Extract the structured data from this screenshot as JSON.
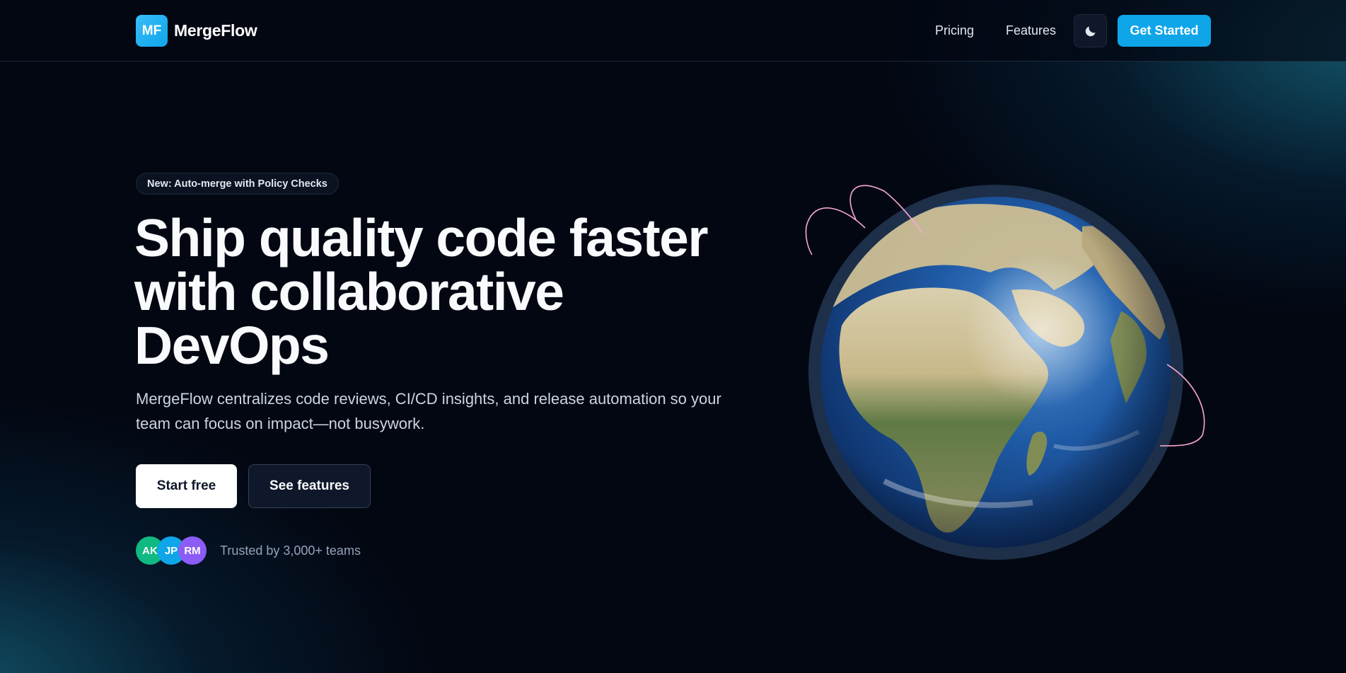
{
  "header": {
    "logo_initials": "MF",
    "brand_name": "MergeFlow",
    "nav": {
      "pricing": "Pricing",
      "features": "Features"
    },
    "theme_toggle_icon": "moon-icon",
    "cta": "Get Started"
  },
  "hero": {
    "badge": "New: Auto-merge with Policy Checks",
    "headline_line1": "Ship quality code faster",
    "headline_line2": "with collaborative",
    "headline_line3": "DevOps",
    "subtext": "MergeFlow centralizes code reviews, CI/CD insights, and release automation so your team can focus on impact—not busywork.",
    "primary_button": "Start free",
    "secondary_button": "See features",
    "avatars": [
      "AK",
      "JP",
      "RM"
    ],
    "trust_text": "Trusted by 3,000+ teams"
  },
  "colors": {
    "background": "#030712",
    "accent": "#0ea5e9",
    "avatar_1": "#10b981",
    "avatar_2": "#0ea5e9",
    "avatar_3": "#8b5cf6",
    "orbit": "#f9a8d4"
  },
  "illustration": {
    "icon": "earth-globe-icon"
  }
}
